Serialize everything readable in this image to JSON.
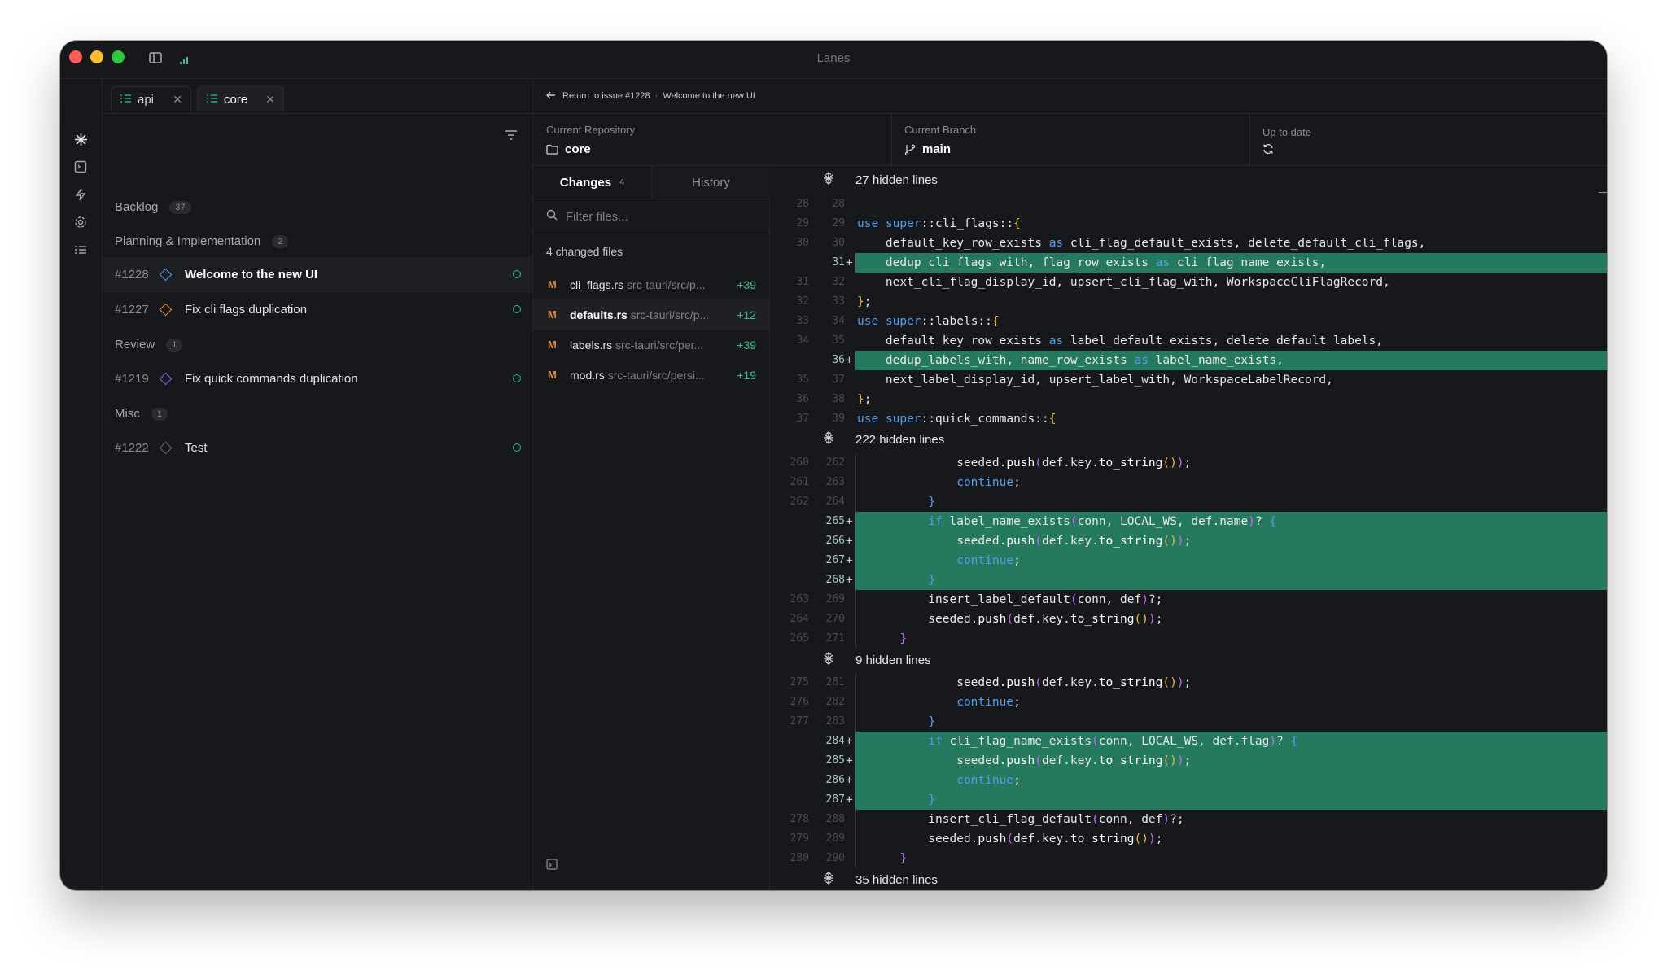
{
  "window": {
    "title": "Lanes"
  },
  "tabs": [
    {
      "label": "api",
      "active": false
    },
    {
      "label": "core",
      "active": true
    }
  ],
  "issues": {
    "groups": [
      {
        "name": "Backlog",
        "count": "37"
      },
      {
        "name": "Planning & Implementation",
        "count": "2"
      },
      {
        "name": "Review",
        "count": "1"
      },
      {
        "name": "Misc",
        "count": "1"
      }
    ],
    "items": [
      {
        "number": "#1228",
        "title": "Welcome to the new UI",
        "priority_color": "#4a9ff5",
        "selected": true
      },
      {
        "number": "#1227",
        "title": "Fix cli flags duplication",
        "priority_color": "#e58b3c",
        "selected": false
      },
      {
        "number": "#1219",
        "title": "Fix quick commands duplication",
        "priority_color": "#7e6af2",
        "selected": false
      },
      {
        "number": "#1222",
        "title": "Test",
        "priority_color": "#6c6d72",
        "selected": false
      }
    ]
  },
  "breadcrumb": {
    "back": "Return to issue #1228",
    "separator": "·",
    "title": "Welcome to the new UI"
  },
  "info": {
    "repo_label": "Current Repository",
    "repo_value": "core",
    "branch_label": "Current Branch",
    "branch_value": "main",
    "status_label": "Up to date"
  },
  "changes": {
    "tab_changes": "Changes",
    "changes_count": "4",
    "tab_history": "History",
    "filter_placeholder": "Filter files...",
    "summary": "4 changed files",
    "files": [
      {
        "status": "M",
        "name": "cli_flags.rs",
        "path": "src-tauri/src/p...",
        "additions": "+39"
      },
      {
        "status": "M",
        "name": "defaults.rs",
        "path": "src-tauri/src/p...",
        "additions": "+12"
      },
      {
        "status": "M",
        "name": "labels.rs",
        "path": "src-tauri/src/per...",
        "additions": "+39"
      },
      {
        "status": "M",
        "name": "mod.rs",
        "path": "src-tauri/src/persi...",
        "additions": "+19"
      }
    ]
  },
  "diff": {
    "hidden": [
      "27 hidden lines",
      "222 hidden lines",
      "9 hidden lines",
      "35 hidden lines"
    ],
    "colors": {
      "added_bg": "#25795f",
      "keyword": "#4da0f0"
    }
  }
}
